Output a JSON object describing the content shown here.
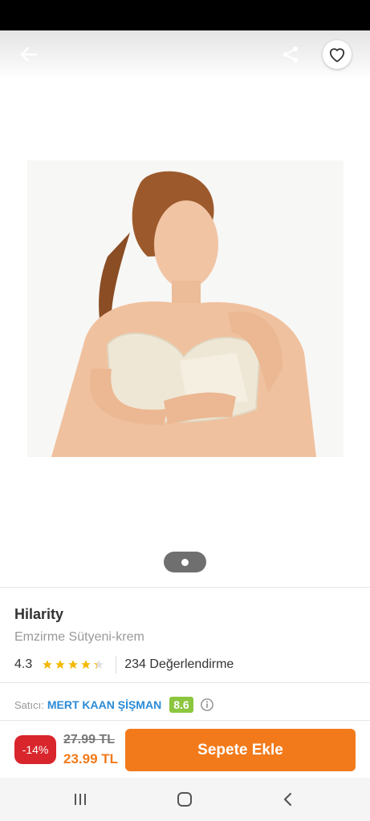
{
  "icons": {
    "back": "arrow-left-icon",
    "share": "share-icon",
    "favorite": "heart-outline-icon",
    "info": "info-icon",
    "recents": "recent-apps-icon",
    "home": "home-icon",
    "nav_back": "chevron-left-icon"
  },
  "gallery": {
    "current_page": 1,
    "total_pages": 1
  },
  "product": {
    "brand": "Hilarity",
    "name": "Emzirme Sütyeni-krem",
    "rating": "4.3",
    "rating_value": 4.3,
    "rating_max": 5,
    "review_count": "234 Değerlendirme"
  },
  "seller": {
    "label": "Satıcı:",
    "name": "MERT KAAN ŞİŞMAN",
    "score": "8.6"
  },
  "purchase": {
    "discount": "-14%",
    "old_price": "27.99 TL",
    "new_price": "23.99 TL",
    "add_to_cart_label": "Sepete Ekle"
  },
  "colors": {
    "accent": "#f27a1a",
    "discount": "#d8262c",
    "star": "#f5b800",
    "seller_link": "#2a8bd6",
    "seller_score": "#8cc63f"
  }
}
